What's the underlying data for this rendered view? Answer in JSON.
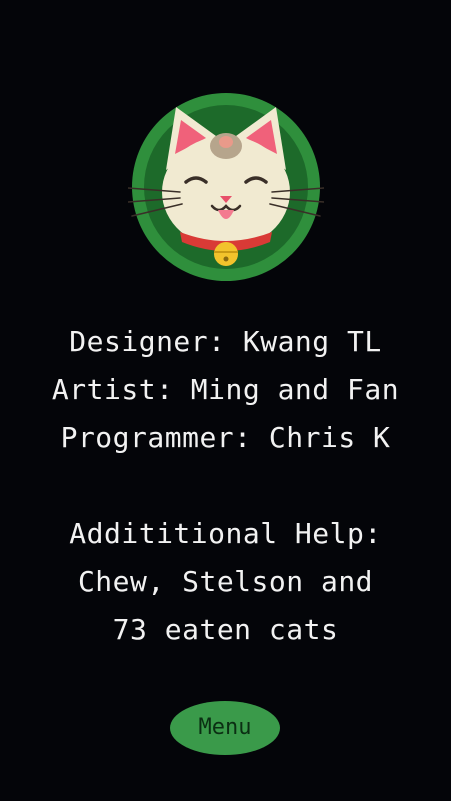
{
  "credits": {
    "designer": "Designer: Kwang TL",
    "artist": "Artist: Ming and Fan",
    "programmer": "Programmer: Chris K",
    "help_heading": "Addititional Help:",
    "help_line1": "Chew, Stelson and",
    "help_line2": "73 eaten cats"
  },
  "menu_button": {
    "label": "Menu"
  },
  "colors": {
    "background": "#040509",
    "logo_ring": "#2f8f3c",
    "logo_inner": "#1d6a2a",
    "menu_button": "#3a9a4a",
    "text": "#f2f2f2"
  },
  "icons": {
    "logo": "lucky-cat-icon"
  }
}
